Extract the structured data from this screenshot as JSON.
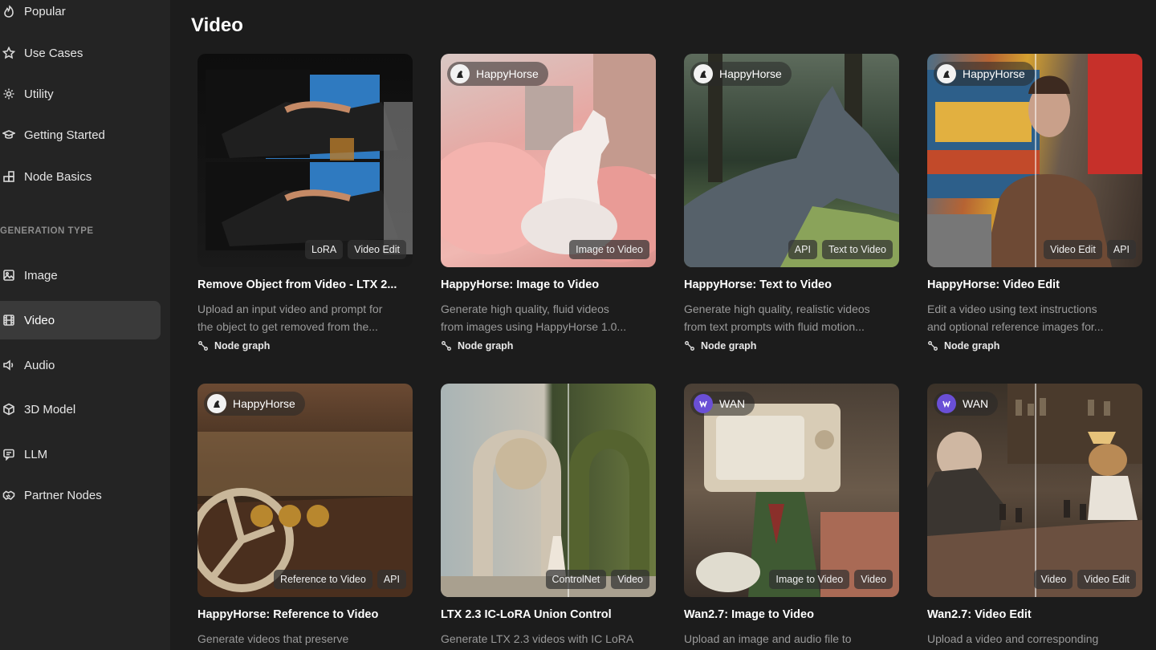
{
  "sidebar": {
    "items_top": [
      {
        "label": "Popular",
        "icon": "flame-icon"
      },
      {
        "label": "Use Cases",
        "icon": "star-icon"
      },
      {
        "label": "Utility",
        "icon": "gear-icon"
      },
      {
        "label": "Getting Started",
        "icon": "graduation-cap-icon"
      },
      {
        "label": "Node Basics",
        "icon": "blocks-icon"
      }
    ],
    "section_label": "GENERATION TYPE",
    "items_type": [
      {
        "label": "Image",
        "icon": "image-icon",
        "active": false
      },
      {
        "label": "Video",
        "icon": "film-icon",
        "active": true
      },
      {
        "label": "Audio",
        "icon": "speaker-icon",
        "active": false
      },
      {
        "label": "3D Model",
        "icon": "cube-icon",
        "active": false
      },
      {
        "label": "LLM",
        "icon": "chat-icon",
        "active": false
      },
      {
        "label": "Partner Nodes",
        "icon": "handshake-icon",
        "active": false
      }
    ]
  },
  "main": {
    "title": "Video",
    "meta_label": "Node graph",
    "cards": [
      {
        "provider": "",
        "tags": [
          "LoRA",
          "Video Edit"
        ],
        "title": "Remove Object from Video - LTX 2...",
        "desc": [
          "Upload an input video and prompt for",
          "the object to get removed from the..."
        ],
        "meta": "Node graph"
      },
      {
        "provider": "HappyHorse",
        "tags": [
          "Image to Video"
        ],
        "title": "HappyHorse: Image to Video",
        "desc": [
          "Generate high quality, fluid videos",
          "from images using HappyHorse 1.0..."
        ],
        "meta": "Node graph"
      },
      {
        "provider": "HappyHorse",
        "tags": [
          "API",
          "Text to Video"
        ],
        "title": "HappyHorse: Text to Video",
        "desc": [
          "Generate high quality, realistic videos",
          "from text prompts with fluid motion..."
        ],
        "meta": "Node graph"
      },
      {
        "provider": "HappyHorse",
        "tags": [
          "Video Edit",
          "API"
        ],
        "title": "HappyHorse: Video Edit",
        "desc": [
          "Edit a video using text instructions",
          "and optional reference images for..."
        ],
        "meta": "Node graph"
      },
      {
        "provider": "HappyHorse",
        "tags": [
          "Reference to Video",
          "API"
        ],
        "title": "HappyHorse: Reference to Video",
        "desc": [
          "Generate videos that preserve",
          ""
        ],
        "meta": ""
      },
      {
        "provider": "",
        "tags": [
          "ControlNet",
          "Video"
        ],
        "title": "LTX 2.3 IC-LoRA Union Control",
        "desc": [
          "Generate LTX 2.3 videos with IC LoRA",
          ""
        ],
        "meta": ""
      },
      {
        "provider": "WAN",
        "tags": [
          "Image to Video",
          "Video"
        ],
        "title": "Wan2.7: Image to Video",
        "desc": [
          "Upload an image and audio file to",
          ""
        ],
        "meta": ""
      },
      {
        "provider": "WAN",
        "tags": [
          "Video",
          "Video Edit"
        ],
        "title": "Wan2.7: Video Edit",
        "desc": [
          "Upload a video and corresponding",
          ""
        ],
        "meta": ""
      }
    ]
  }
}
